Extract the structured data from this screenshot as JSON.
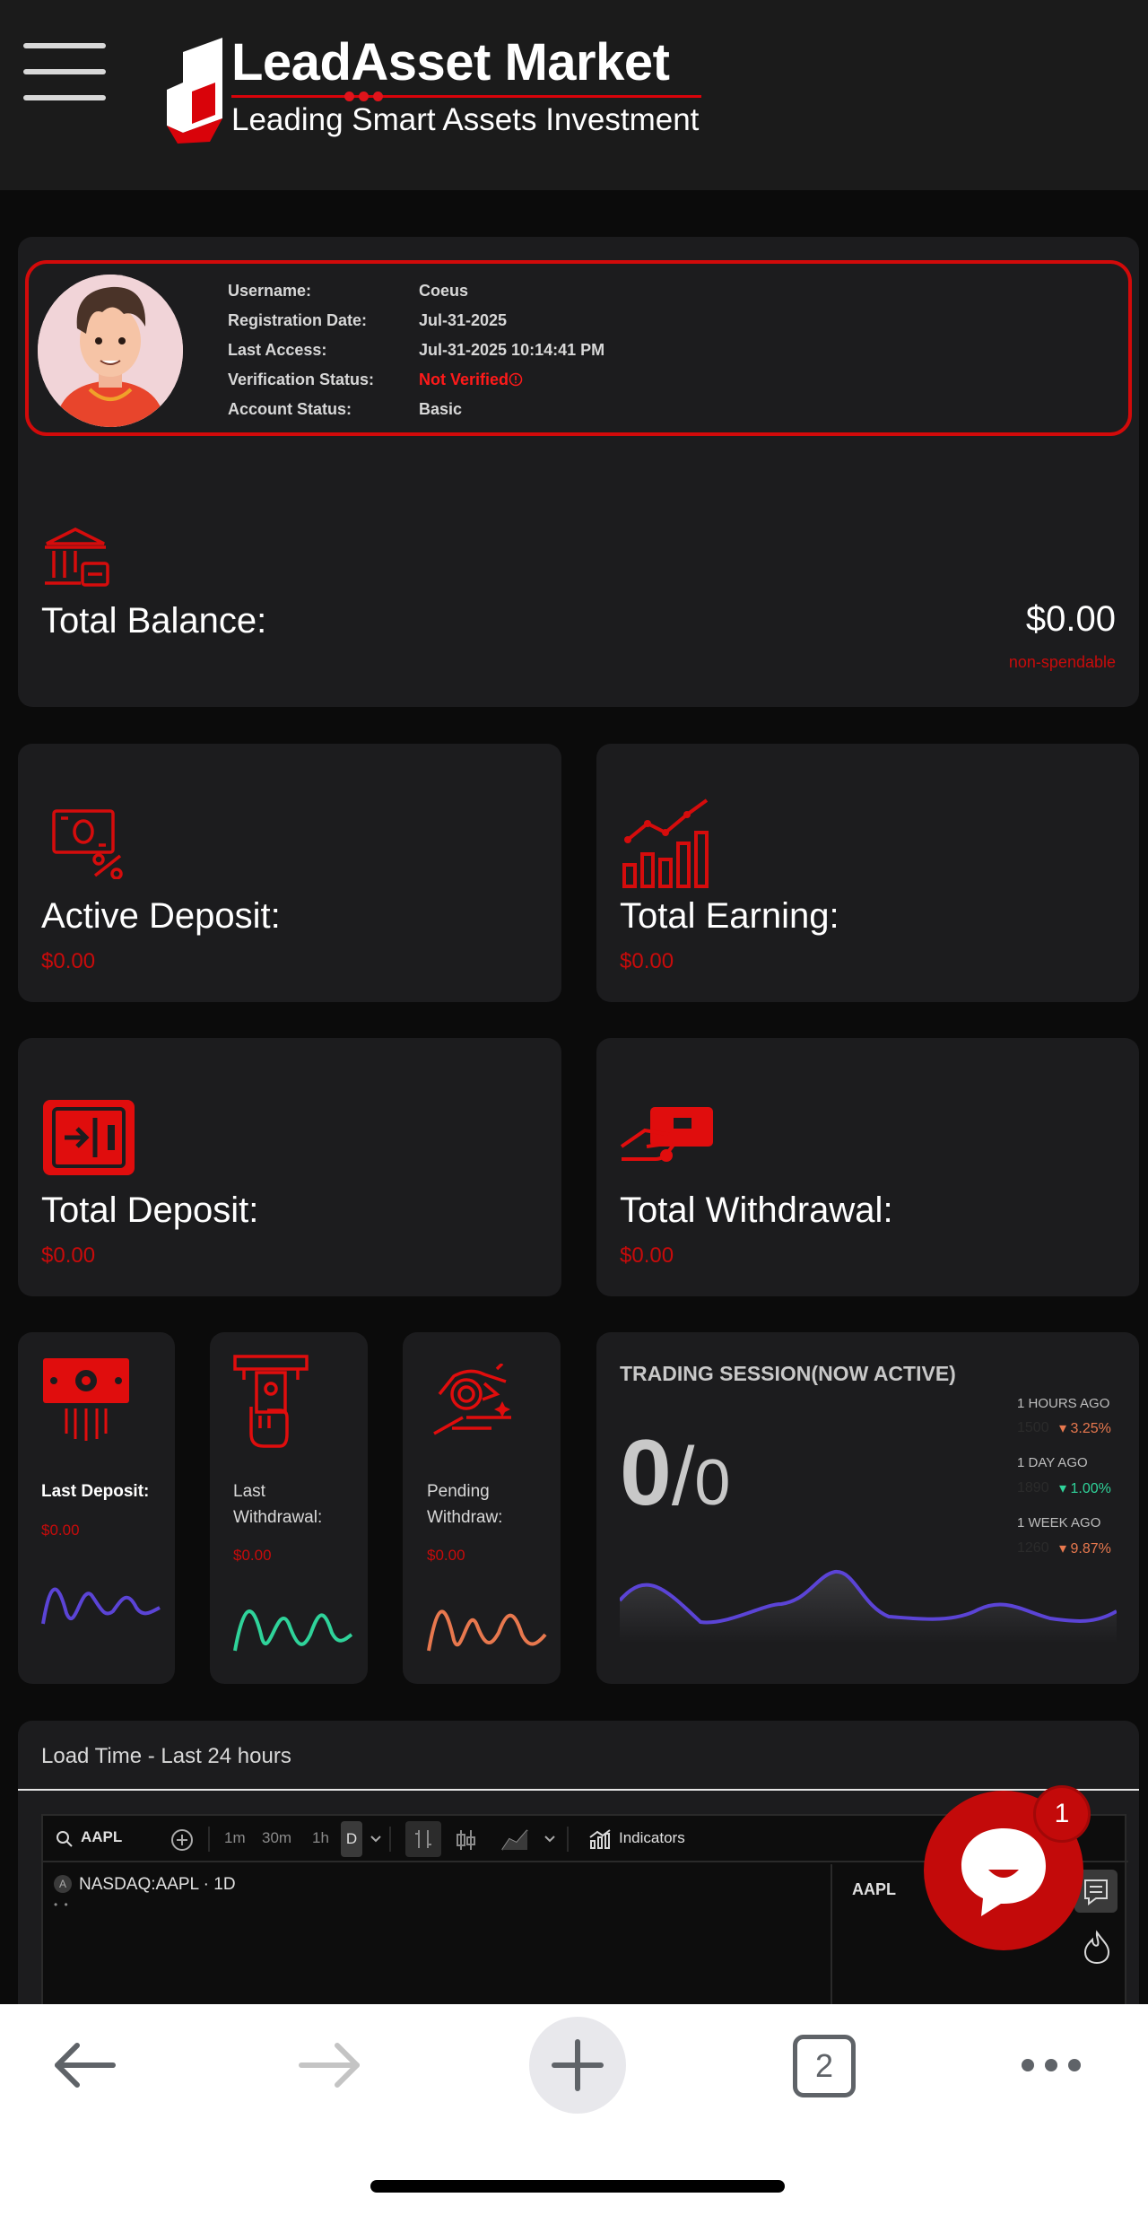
{
  "header": {
    "brand_name": "LeadAsset Market",
    "tagline": "Leading Smart Assets Investment"
  },
  "profile": {
    "fields": [
      {
        "label": "Username:",
        "value": "Coeus"
      },
      {
        "label": "Registration Date:",
        "value": "Jul-31-2025"
      },
      {
        "label": "Last Access:",
        "value": "Jul-31-2025 10:14:41 PM"
      },
      {
        "label": "Verification Status:",
        "value": "Not Verified"
      },
      {
        "label": "Account Status:",
        "value": "Basic"
      }
    ]
  },
  "balance": {
    "label": "Total Balance:",
    "value": "$0.00",
    "note": "non-spendable"
  },
  "stats": {
    "active_deposit": {
      "label": "Active Deposit:",
      "value": "$0.00"
    },
    "total_earning": {
      "label": "Total Earning:",
      "value": "$0.00"
    },
    "total_deposit": {
      "label": "Total Deposit:",
      "value": "$0.00"
    },
    "total_withdrawal": {
      "label": "Total Withdrawal:",
      "value": "$0.00"
    }
  },
  "mini": {
    "last_deposit": {
      "label": "Last Deposit:",
      "value": "$0.00"
    },
    "last_withdrawal": {
      "label_1": "Last",
      "label_2": "Withdrawal:",
      "value": "$0.00"
    },
    "pending_withdraw": {
      "label_1": "Pending",
      "label_2": "Withdraw:",
      "value": "$0.00"
    }
  },
  "trading": {
    "title": "TRADING SESSION(NOW ACTIVE)",
    "count_big": "0",
    "count_sep": "/",
    "count_small": "0",
    "history": [
      {
        "label": "1 HOURS AGO",
        "num": "1500",
        "pct": "3.25%",
        "dir": "down"
      },
      {
        "label": "1 DAY AGO",
        "num": "1890",
        "pct": "1.00%",
        "dir": "up"
      },
      {
        "label": "1 WEEK AGO",
        "num": "1260",
        "pct": "9.87%",
        "dir": "down"
      }
    ]
  },
  "load_time": {
    "title": "Load Time - Last 24 hours",
    "symbol": "AAPL",
    "intervals": [
      "1m",
      "30m",
      "1h",
      "D"
    ],
    "indicators_label": "Indicators",
    "chart_title": "NASDAQ:AAPL · 1D",
    "watch_symbol": "AAPL",
    "legend_badge": "A"
  },
  "chat": {
    "badge": "1"
  },
  "browser": {
    "tab_count": "2"
  },
  "colors": {
    "accent": "#c80b0b",
    "card_bg": "#1c1c1e",
    "purple": "#5b44d6",
    "green": "#2fd39a",
    "orange": "#e8784e"
  }
}
